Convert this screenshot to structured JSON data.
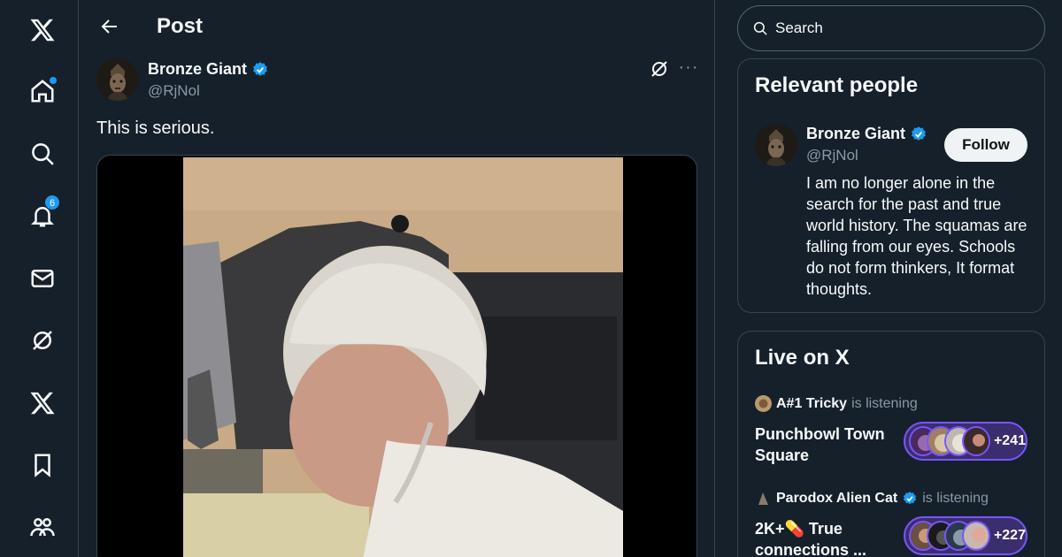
{
  "nav": {
    "notifications_count": "6",
    "items": [
      "x-logo",
      "home",
      "explore",
      "notifications",
      "messages",
      "grok",
      "premium",
      "bookmarks",
      "communities"
    ]
  },
  "header": {
    "title": "Post"
  },
  "post": {
    "author_name": "Bronze Giant",
    "author_handle": "@RjNol",
    "text": "This is serious."
  },
  "search": {
    "placeholder": "Search"
  },
  "relevant_people": {
    "title": "Relevant people",
    "name": "Bronze Giant",
    "handle": "@RjNol",
    "follow_label": "Follow",
    "bio": "I am no longer alone in the search for the past and true world history. The squamas are falling from our eyes. Schools do not form thinkers, It format thoughts."
  },
  "live": {
    "title": "Live on X",
    "spaces": [
      {
        "user": "A#1 Tricky",
        "status": "is listening",
        "title": "Punchbowl Town Square",
        "count": "+241"
      },
      {
        "user": "Parodox Alien Cat",
        "status": "is listening",
        "title": "2K+💊 True connections ...",
        "count": "+227"
      }
    ]
  },
  "colors": {
    "accent": "#1d9bf0",
    "spaces": "#7856ff",
    "background": "#15202b"
  }
}
